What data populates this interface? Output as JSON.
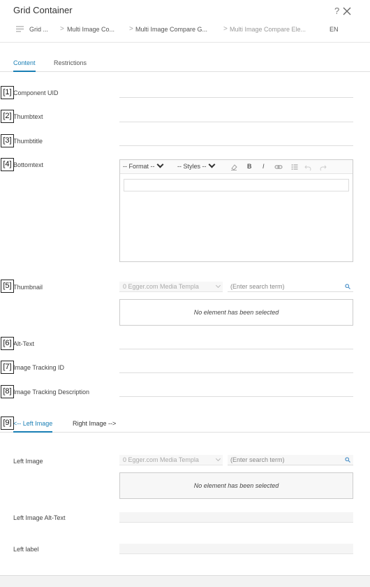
{
  "window": {
    "title": "Grid Container",
    "help_label": "?"
  },
  "breadcrumb": {
    "items": [
      {
        "label": "Grid ..."
      },
      {
        "label": "Multi Image Co..."
      },
      {
        "label": "Multi Image Compare G..."
      },
      {
        "label": "Multi Image Compare Ele..."
      }
    ],
    "separator": ">",
    "language": "EN"
  },
  "tabs": [
    {
      "label": "Content",
      "active": true
    },
    {
      "label": "Restrictions",
      "active": false
    }
  ],
  "markers": [
    "[1]",
    "[2]",
    "[3]",
    "[4]",
    "[5]",
    "[6]",
    "[7]",
    "[8]",
    "[9]"
  ],
  "fields": {
    "component_uid": {
      "label": "Component UID",
      "value": ""
    },
    "thumbtext": {
      "label": "Thumbtext",
      "value": ""
    },
    "thumbtitle": {
      "label": "Thumbtitle",
      "value": ""
    },
    "bottomtext": {
      "label": "Bottomtext"
    },
    "thumbnail": {
      "label": "Thumbnail"
    },
    "alt_text": {
      "label": "Alt-Text",
      "value": ""
    },
    "tracking_id": {
      "label": "Image Tracking ID",
      "value": ""
    },
    "tracking_desc": {
      "label": "Image Tracking Description",
      "value": ""
    }
  },
  "editor": {
    "format_label": "-- Format --",
    "styles_label": "-- Styles --",
    "bold": "B",
    "italic": "I"
  },
  "media_picker": {
    "repository": "0 Egger.com Media Templa",
    "search_placeholder": "(Enter search term)",
    "empty_text": "No element has been selected"
  },
  "image_tabs": [
    {
      "label": "<-- Left Image",
      "active": true
    },
    {
      "label": "Right Image -->",
      "active": false
    }
  ],
  "left_image": {
    "label": "Left Image",
    "alt_label": "Left Image Alt-Text",
    "label_field": "Left label"
  },
  "colors": {
    "accent": "#1a7fb5"
  }
}
